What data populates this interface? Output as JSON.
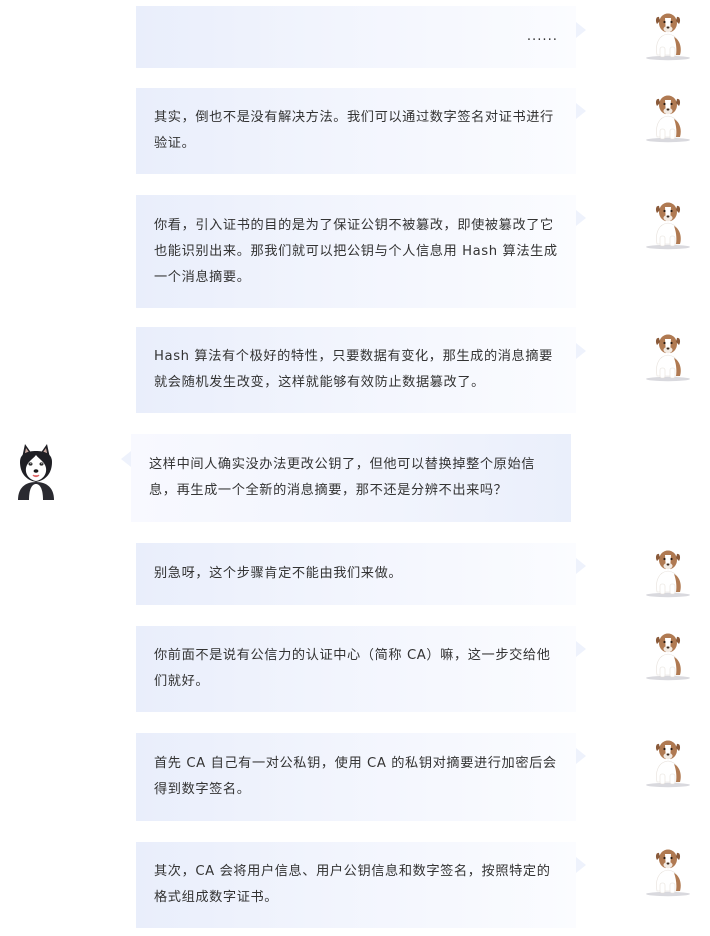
{
  "avatars": {
    "right": "puppy-avatar",
    "left": "husky-avatar"
  },
  "colors": {
    "bubble_gradient_start": "#e9eefb",
    "bubble_gradient_end": "#fbfcff",
    "text": "#333333",
    "puppy_fur": "#b07a52",
    "husky_fur": "#1f1f24"
  },
  "messages": [
    {
      "sender": "right",
      "text": "......"
    },
    {
      "sender": "right",
      "text": "其实，倒也不是没有解决方法。我们可以通过数字签名对证书进行验证。"
    },
    {
      "sender": "right",
      "text": "你看，引入证书的目的是为了保证公钥不被篡改，即使被篡改了它也能识别出来。那我们就可以把公钥与个人信息用 Hash 算法生成一个消息摘要。"
    },
    {
      "sender": "right",
      "text": "Hash 算法有个极好的特性，只要数据有变化，那生成的消息摘要就会随机发生改变，这样就能够有效防止数据篡改了。"
    },
    {
      "sender": "left",
      "text": "这样中间人确实没办法更改公钥了，但他可以替换掉整个原始信息，再生成一个全新的消息摘要，那不还是分辨不出来吗？"
    },
    {
      "sender": "right",
      "text": "别急呀，这个步骤肯定不能由我们来做。"
    },
    {
      "sender": "right",
      "text": "你前面不是说有公信力的认证中心（简称 CA）嘛，这一步交给他们就好。"
    },
    {
      "sender": "right",
      "text": "首先 CA 自己有一对公私钥，使用 CA 的私钥对摘要进行加密后会得到数字签名。"
    },
    {
      "sender": "right",
      "text": "其次，CA 会将用户信息、用户公钥信息和数字签名，按照特定的格式组成数字证书。"
    }
  ]
}
